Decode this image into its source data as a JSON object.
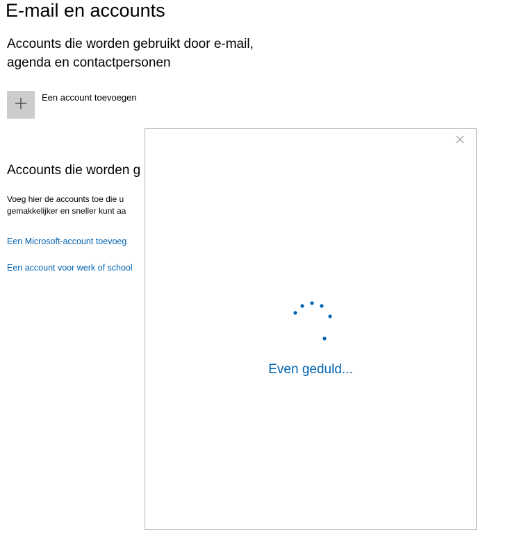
{
  "page": {
    "title": "E-mail en accounts"
  },
  "email_section": {
    "heading": "Accounts die worden gebruikt door e-mail, agenda en contactpersonen",
    "add_account_label": "Een account toevoegen"
  },
  "other_section": {
    "heading": "Accounts die worden g",
    "description_line1": "Voeg hier de accounts toe die u",
    "description_line2": "gemakkelijker en sneller kunt aa",
    "microsoft_link": "Een Microsoft-account toevoeg",
    "work_link": "Een account voor werk of school"
  },
  "dialog": {
    "wait_text": "Even geduld...",
    "close_icon": "close-icon",
    "spinner_icon": "loading-spinner-icon"
  },
  "colors": {
    "accent": "#0063b1",
    "tile": "#cccccc",
    "dialog_border": "#b4b4b4"
  }
}
